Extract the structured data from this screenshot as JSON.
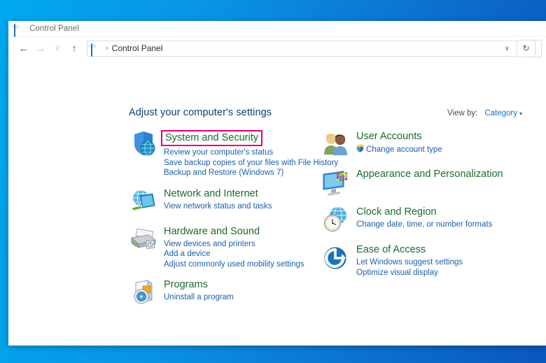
{
  "window": {
    "title": "Control Panel",
    "title_icon": "control-panel-icon"
  },
  "nav": {
    "back": "←",
    "forward": "→",
    "recent": "∨",
    "up": "↑",
    "refresh": "↻",
    "address_chevron": "∨",
    "breadcrumb_separator": "›",
    "breadcrumb": "Control Panel"
  },
  "main": {
    "heading": "Adjust your computer's settings",
    "view_by_label": "View by:",
    "view_by_value": "Category",
    "view_by_caret": "▾",
    "highlight_color": "#e4007f"
  },
  "categories_left": [
    {
      "icon": "shield-security-icon",
      "title": "System and Security",
      "highlighted": true,
      "links": [
        "Review your computer's status",
        "Save backup copies of your files with File History",
        "Backup and Restore (Windows 7)"
      ]
    },
    {
      "icon": "network-internet-icon",
      "title": "Network and Internet",
      "highlighted": false,
      "links": [
        "View network status and tasks"
      ]
    },
    {
      "icon": "hardware-sound-printer-icon",
      "title": "Hardware and Sound",
      "highlighted": false,
      "links": [
        "View devices and printers",
        "Add a device",
        "Adjust commonly used mobility settings"
      ]
    },
    {
      "icon": "programs-icon",
      "title": "Programs",
      "highlighted": false,
      "links": [
        "Uninstall a program"
      ]
    }
  ],
  "categories_right": [
    {
      "icon": "user-accounts-icon",
      "title": "User Accounts",
      "highlighted": false,
      "links": [
        "Change account type"
      ],
      "link_shield_index": 0
    },
    {
      "icon": "appearance-personalization-icon",
      "title": "Appearance and Personalization",
      "highlighted": false,
      "links": []
    },
    {
      "icon": "clock-region-icon",
      "title": "Clock and Region",
      "highlighted": false,
      "links": [
        "Change date, time, or number formats"
      ]
    },
    {
      "icon": "ease-of-access-icon",
      "title": "Ease of Access",
      "highlighted": false,
      "links": [
        "Let Windows suggest settings",
        "Optimize visual display"
      ]
    }
  ]
}
